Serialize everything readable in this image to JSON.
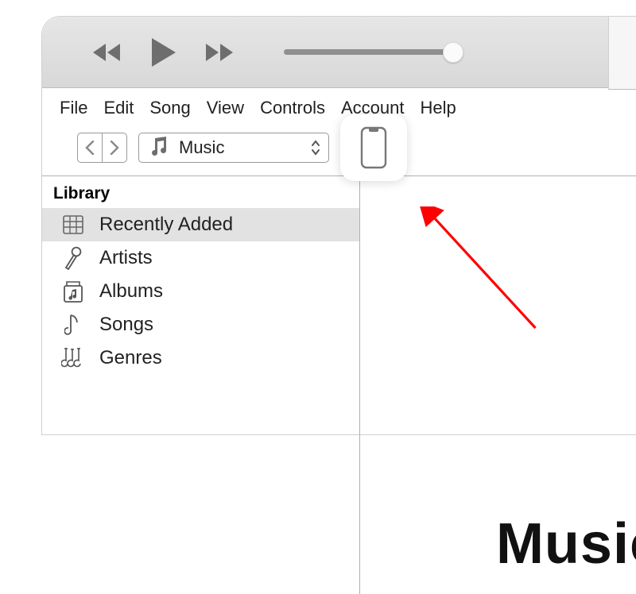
{
  "menu": {
    "file": "File",
    "edit": "Edit",
    "song": "Song",
    "view": "View",
    "controls": "Controls",
    "account": "Account",
    "help": "Help"
  },
  "source": {
    "label": "Music"
  },
  "sidebar": {
    "header": "Library",
    "items": [
      {
        "label": "Recently Added"
      },
      {
        "label": "Artists"
      },
      {
        "label": "Albums"
      },
      {
        "label": "Songs"
      },
      {
        "label": "Genres"
      }
    ]
  },
  "annotation": {
    "big": "Music"
  }
}
